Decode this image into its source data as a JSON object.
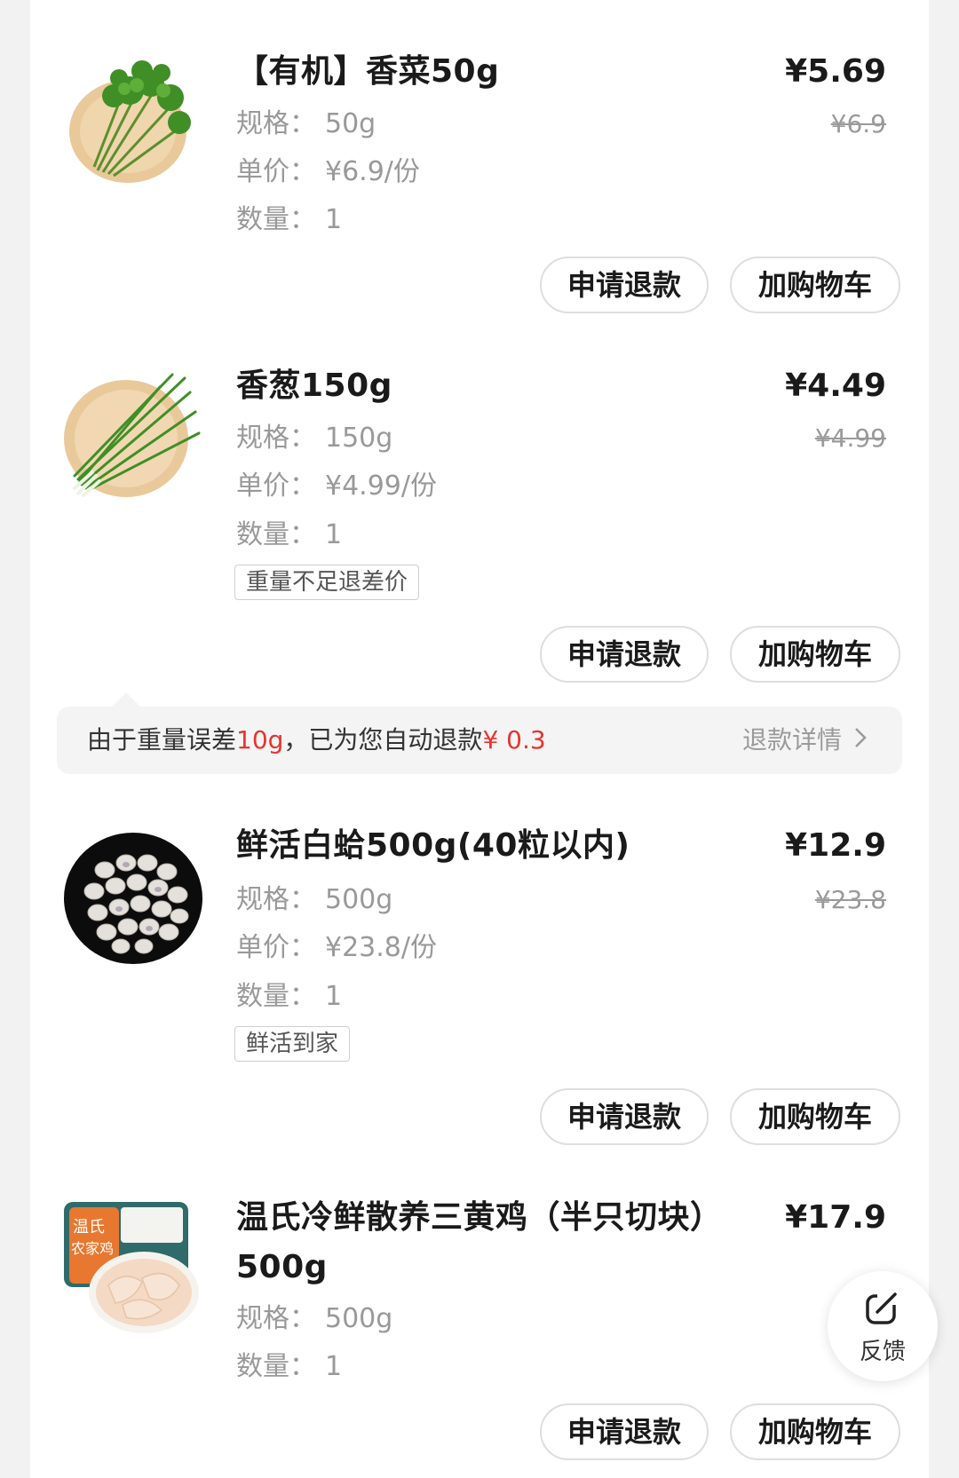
{
  "labels": {
    "spec": "规格：",
    "unit_price": "单价：",
    "quantity": "数量：",
    "refund_button": "申请退款",
    "cart_button": "加购物车"
  },
  "items": [
    {
      "name": "【有机】香菜50g",
      "price": "¥5.69",
      "original_price": "¥6.9",
      "spec": "50g",
      "unit_price": "¥6.9/份",
      "quantity": "1"
    },
    {
      "name": "香葱150g",
      "price": "¥4.49",
      "original_price": "¥4.99",
      "spec": "150g",
      "unit_price": "¥4.99/份",
      "quantity": "1",
      "tag": "重量不足退差价"
    },
    {
      "name": "鲜活白蛤500g(40粒以内)",
      "price": "¥12.9",
      "original_price": "¥23.8",
      "spec": "500g",
      "unit_price": "¥23.8/份",
      "quantity": "1",
      "tag": "鲜活到家"
    },
    {
      "name_line1": "温氏冷鲜散养三黄鸡（半只切块）",
      "name_line2": "500g",
      "price": "¥17.9",
      "spec": "500g",
      "quantity": "1",
      "package_text_1": "温氏",
      "package_text_2": "农家鸡"
    }
  ],
  "notice": {
    "prefix": "由于重量误差",
    "weight": "10g",
    "middle": "，已为您自动退款",
    "amount": "¥ 0.3",
    "detail_link": "退款详情"
  },
  "feedback": {
    "label": "反馈"
  },
  "icons": [
    "cilantro-thumbnail",
    "scallion-thumbnail",
    "clam-thumbnail",
    "chicken-thumbnail",
    "chevron-right-icon",
    "edit-icon"
  ],
  "colors": {
    "accent_red": "#e8332f",
    "muted": "#999999"
  }
}
